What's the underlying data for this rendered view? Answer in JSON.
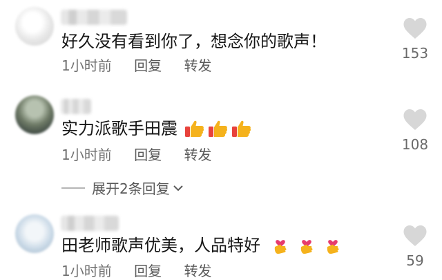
{
  "comments": [
    {
      "username": "",
      "text": "好久没有看到你了，想念你的歌声！",
      "time": "1小时前",
      "reply_label": "回复",
      "share_label": "转发",
      "likes": "153",
      "emoji": []
    },
    {
      "username": "",
      "text": "实力派歌手田震",
      "time": "1小时前",
      "reply_label": "回复",
      "share_label": "转发",
      "likes": "108",
      "emoji": [
        "thumbs-up",
        "thumbs-up",
        "thumbs-up"
      ],
      "expand_label": "展开2条回复"
    },
    {
      "username": "",
      "text": "田老师歌声优美，人品特好",
      "time": "1小时前",
      "reply_label": "回复",
      "share_label": "转发",
      "likes": "59",
      "emoji": [
        "finger-heart",
        "finger-heart",
        "finger-heart"
      ]
    }
  ],
  "colors": {
    "text": "#161616",
    "meta": "#707070",
    "heart": "#d7d7d7",
    "thumb": "#f5b21c",
    "sleeve": "#e8423c",
    "finger_heart": "#e63b6e"
  }
}
